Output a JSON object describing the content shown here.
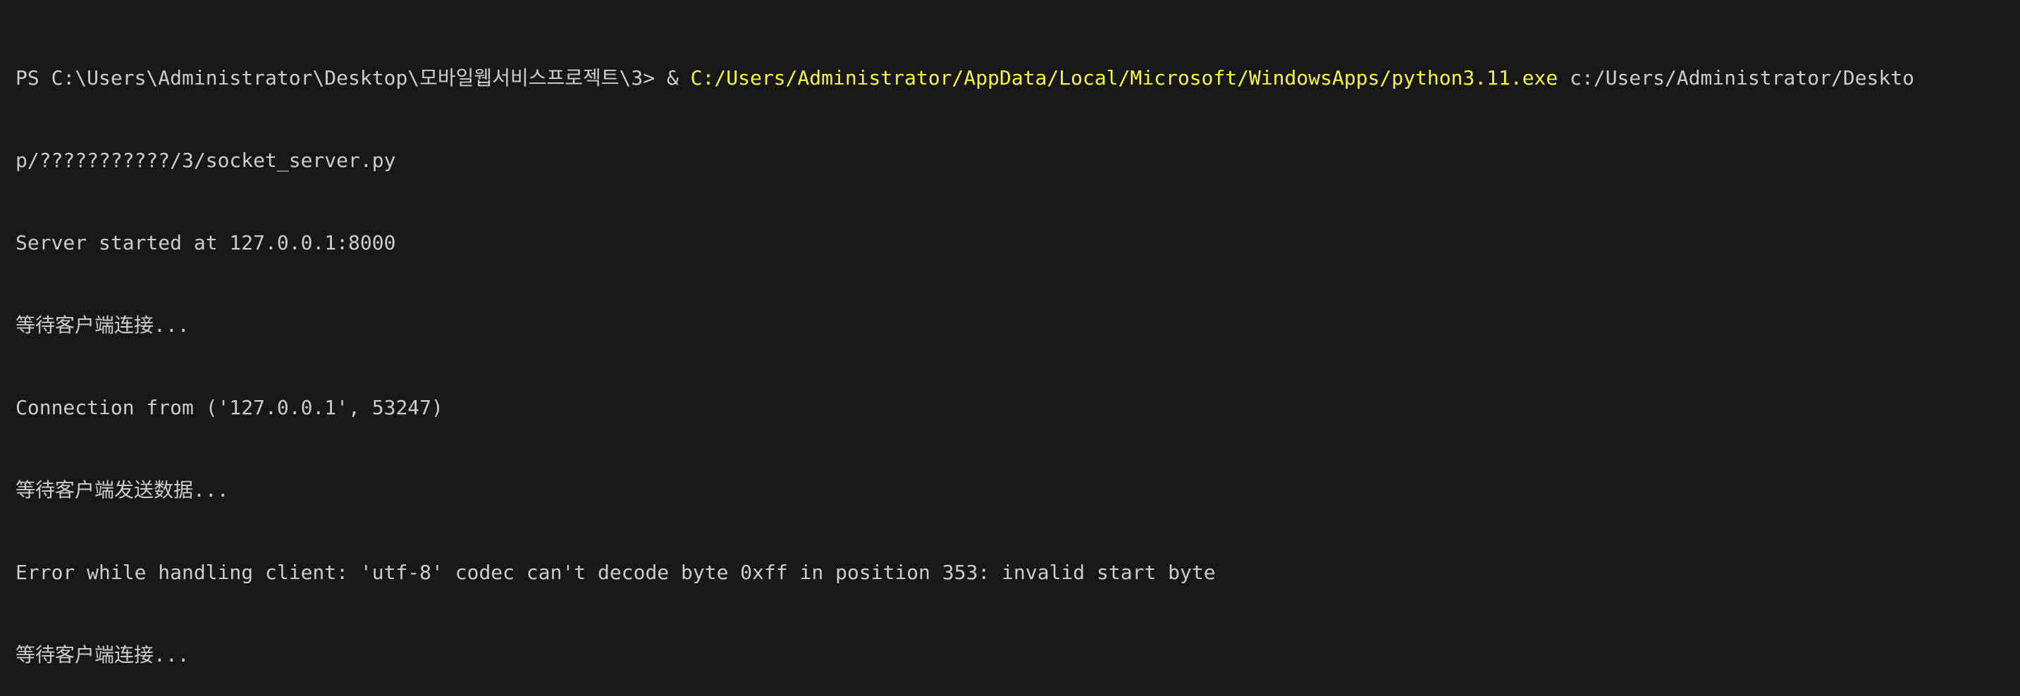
{
  "terminal": {
    "command": {
      "prompt": "PS C:\\Users\\Administrator\\Desktop\\모바일웹서비스프로젝트\\3> ",
      "operator": "& ",
      "executable": "C:/Users/Administrator/AppData/Local/Microsoft/WindowsApps/python3.11.exe",
      "argument_part1": " c:/Users/Administrator/Deskto",
      "argument_part2": "p/???????????/3/socket_server.py"
    },
    "output_lines": [
      "Server started at 127.0.0.1:8000",
      "等待客户端连接...",
      "Connection from ('127.0.0.1', 53247)",
      "等待客户端发送数据...",
      "Error while handling client: 'utf-8' codec can't decode byte 0xff in position 353: invalid start byte",
      "等待客户端连接..."
    ],
    "colors": {
      "background": "#181818",
      "text": "#cccccc",
      "executable": "#f5f543"
    }
  }
}
